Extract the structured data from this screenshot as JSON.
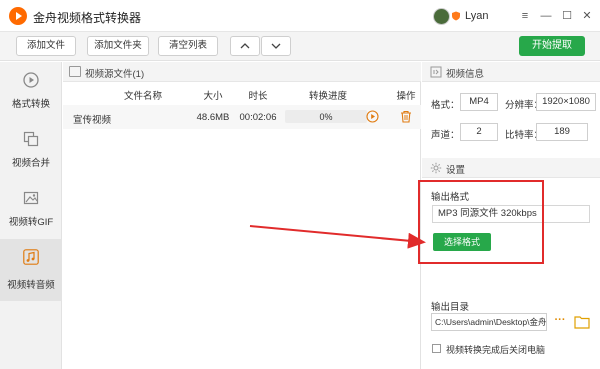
{
  "app": {
    "title": "金舟视频格式转换器"
  },
  "user": {
    "name": "Lyan"
  },
  "window_controls": {
    "menu": "≡",
    "minimize": "—",
    "maximize": "☐",
    "close": "✕"
  },
  "toolbar": {
    "add_file": "添加文件",
    "add_folder": "添加文件夹",
    "clear_list": "清空列表",
    "move_up": "︿",
    "move_down": "﹀",
    "start": "开始提取"
  },
  "sidebar": {
    "items": [
      {
        "label": "格式转换",
        "icon": "play-circle-icon",
        "active": false
      },
      {
        "label": "视频合并",
        "icon": "merge-icon",
        "active": false
      },
      {
        "label": "视频转GIF",
        "icon": "image-icon",
        "active": false
      },
      {
        "label": "视频转音频",
        "icon": "music-note-icon",
        "active": true
      }
    ]
  },
  "file_panel": {
    "header": "视频源文件(1)",
    "columns": [
      "文件名称",
      "大小",
      "时长",
      "转换进度",
      "操作"
    ],
    "rows": [
      {
        "name": "宣传视频",
        "size": "48.6MB",
        "duration": "00:02:06",
        "progress": "0%",
        "progress_value": 0
      }
    ]
  },
  "video_info": {
    "header": "视频信息",
    "format_label": "格式：",
    "format_value": "MP4",
    "resolution_label": "分辨率：",
    "resolution_value": "1920×1080",
    "channels_label": "声道：",
    "channels_value": "2",
    "bitrate_label": "比特率：",
    "bitrate_value": "189"
  },
  "settings": {
    "header": "设置",
    "output_format_label": "输出格式",
    "output_format_value": "MP3 同源文件 320kbps",
    "choose_format_button": "选择格式",
    "output_dir_label": "输出目录",
    "output_dir_value": "C:\\Users\\admin\\Desktop\\金舟视",
    "browse_button": "···",
    "shutdown_checkbox_label": "视频转换完成后关闭电脑",
    "shutdown_checked": false
  },
  "colors": {
    "accent_green": "#27a84a",
    "annotation_red": "#e12b2b",
    "logo_orange": "#ff6a00"
  }
}
